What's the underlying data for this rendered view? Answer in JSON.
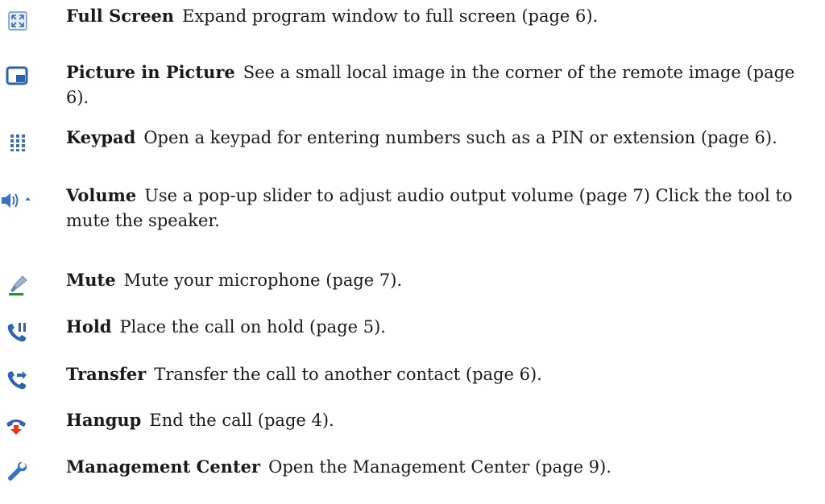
{
  "entries": [
    {
      "name": "Full Screen",
      "description": "Expand program window to full screen (page 6).",
      "icon": "full-screen-icon"
    },
    {
      "name": "Picture in Picture",
      "description": "See a small local image in the corner of the remote image (page 6).",
      "icon": "picture-in-picture-icon"
    },
    {
      "name": "Keypad",
      "description": "Open a keypad for entering numbers such as a PIN or extension (page 6).",
      "icon": "keypad-icon"
    },
    {
      "name": "Volume",
      "description": "Use a pop-up slider to adjust audio output volume (page 7)  Click the tool to mute the speaker.",
      "icon": "volume-icon"
    },
    {
      "name": "Mute",
      "description": "Mute your microphone (page 7).",
      "icon": "microphone-mute-icon"
    },
    {
      "name": "Hold",
      "description": "Place the call on hold (page 5).",
      "icon": "hold-icon"
    },
    {
      "name": "Transfer",
      "description": "Transfer the call to another contact (page 6).",
      "icon": "transfer-icon"
    },
    {
      "name": "Hangup",
      "description": "End the call (page 4).",
      "icon": "hangup-icon"
    },
    {
      "name": "Management Center",
      "description": "Open the Management Center (page 9).",
      "icon": "wrench-icon"
    }
  ]
}
